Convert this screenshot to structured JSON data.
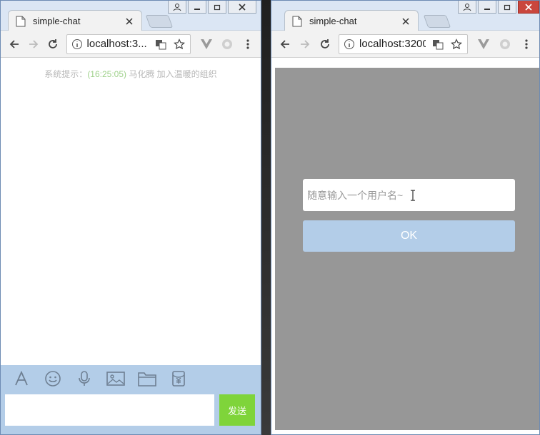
{
  "left_window": {
    "tab_title": "simple-chat",
    "url": "localhost:3...",
    "system_message": {
      "prefix": "系统提示：",
      "time": "(16:25:05)",
      "text": " 马化腾 加入温暖的组织"
    },
    "toolbar_icons": [
      "font-icon",
      "emoji-icon",
      "microphone-icon",
      "image-icon",
      "folder-icon",
      "red-packet-icon"
    ],
    "input_value": "",
    "send_label": "发送"
  },
  "right_window": {
    "tab_title": "simple-chat",
    "url": "localhost:3200",
    "username_placeholder": "随意输入一个用户名~",
    "ok_label": "OK"
  },
  "colors": {
    "chat_bar": "#b3cde8",
    "send_button": "#7fd43a",
    "overlay": "#979797",
    "time_text": "#9fd18b"
  }
}
